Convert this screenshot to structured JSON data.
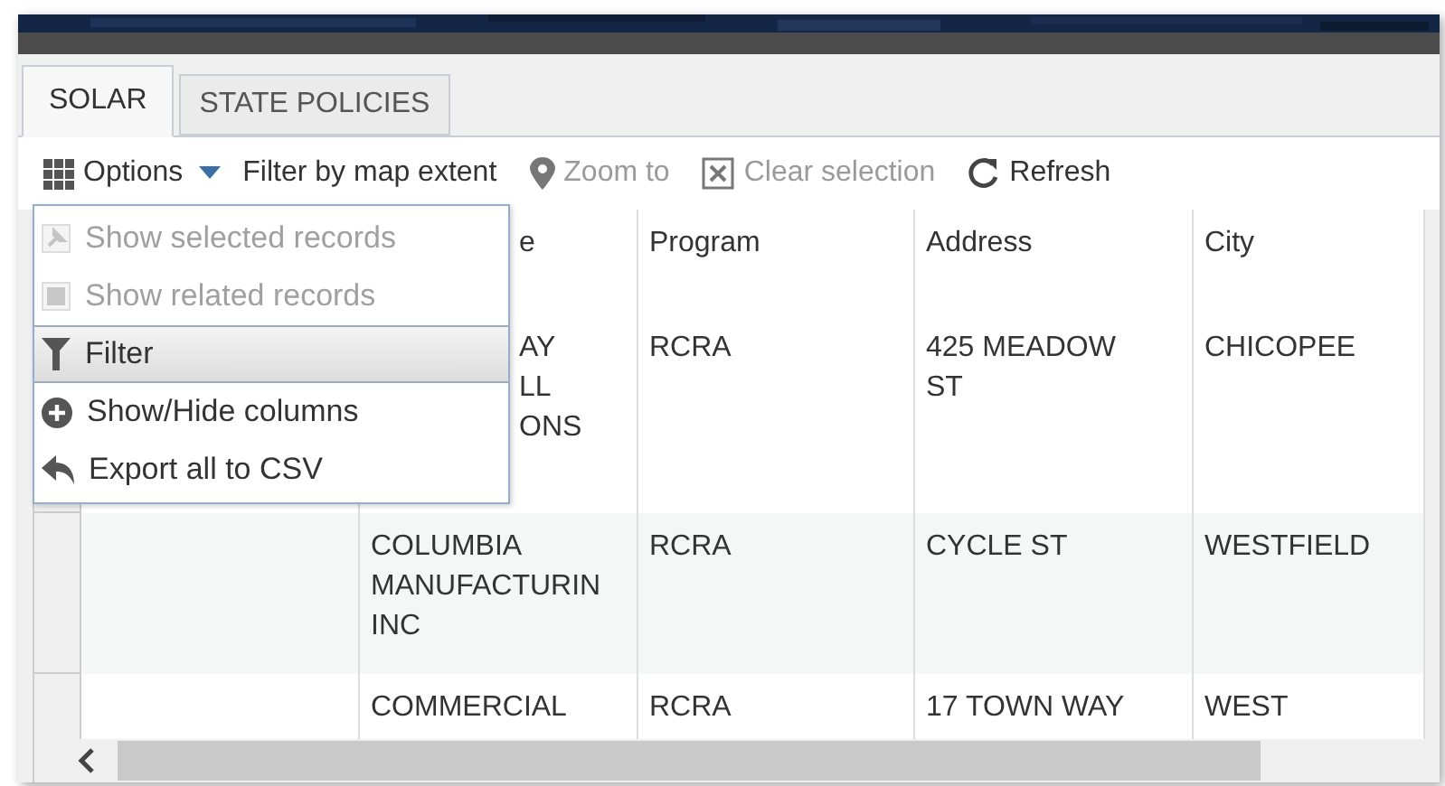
{
  "tabs": [
    {
      "label": "SOLAR",
      "selected": true
    },
    {
      "label": "STATE POLICIES",
      "selected": false
    }
  ],
  "toolbar": [
    {
      "kind": "options",
      "label": "Options",
      "disabled": false
    },
    {
      "kind": "extent",
      "label": "Filter by map extent",
      "disabled": false
    },
    {
      "kind": "zoom",
      "label": "Zoom to",
      "disabled": true
    },
    {
      "kind": "clear",
      "label": "Clear selection",
      "disabled": true
    },
    {
      "kind": "refresh",
      "label": "Refresh",
      "disabled": false
    }
  ],
  "options_menu": [
    {
      "kind": "pin",
      "label": "Show selected records",
      "disabled": true,
      "selected": false
    },
    {
      "kind": "related",
      "label": "Show related records",
      "disabled": true,
      "selected": false
    },
    {
      "kind": "filter",
      "label": "Filter",
      "disabled": false,
      "selected": true
    },
    {
      "kind": "columns",
      "label": "Show/Hide columns",
      "disabled": false,
      "selected": false
    },
    {
      "kind": "export",
      "label": "Export all to CSV",
      "disabled": false,
      "selected": false
    }
  ],
  "table": {
    "columns": [
      "e",
      "Program",
      "Address",
      "City"
    ],
    "rows": [
      {
        "column_2": "AY\nLL\nONS",
        "program": "RCRA",
        "address": "425 MEADOW ST",
        "city": "CHICOPEE"
      },
      {
        "column_2": "COLUMBIA MANUFACTURIN INC",
        "program": "RCRA",
        "address": "CYCLE ST",
        "city": "WESTFIELD"
      },
      {
        "column_2": "COMMERCIAL",
        "program": "RCRA",
        "address": "17 TOWN WAY",
        "city": "WEST"
      }
    ]
  }
}
